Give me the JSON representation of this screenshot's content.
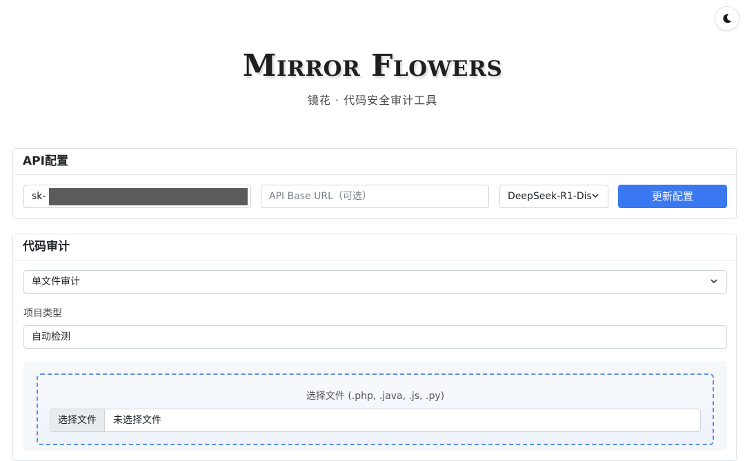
{
  "header": {
    "brand": "Mirror Flowers",
    "subtitle": "镜花 · 代码安全审计工具"
  },
  "theme_toggle": {
    "icon": "moon-icon"
  },
  "api_config": {
    "title": "API配置",
    "api_key_value": "sk-",
    "base_url_placeholder": "API Base URL（可选）",
    "model_selected": "DeepSeek-R1-Dis",
    "update_button": "更新配置"
  },
  "code_audit": {
    "title": "代码审计",
    "mode_selected": "单文件审计",
    "project_type_label": "项目类型",
    "project_type_selected": "自动检测",
    "upload": {
      "hint": "选择文件 (.php, .java, .js, .py)",
      "choose_button": "选择文件",
      "no_file_text": "未选择文件"
    }
  },
  "colors": {
    "primary": "#3a78f2",
    "dropzone_border": "#5b8fe8"
  }
}
